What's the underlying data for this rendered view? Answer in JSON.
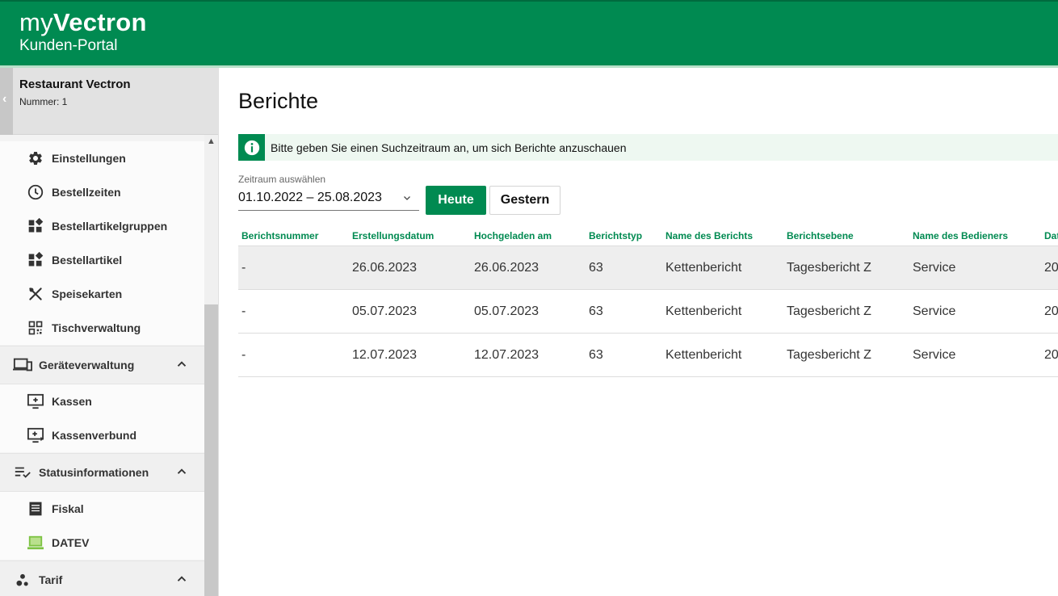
{
  "header": {
    "logo_prefix": "my",
    "logo_brand": "Vectron",
    "subtitle": "Kunden-Portal",
    "brand_color": "#008a51"
  },
  "sidebar": {
    "restaurant_name": "Restaurant Vectron",
    "restaurant_number": "Nummer: 1",
    "items": [
      {
        "label": "Einstellungen",
        "icon": "gear-icon"
      },
      {
        "label": "Bestellzeiten",
        "icon": "clock-icon"
      },
      {
        "label": "Bestellartikelgruppen",
        "icon": "widgets-icon"
      },
      {
        "label": "Bestellartikel",
        "icon": "widgets-icon"
      },
      {
        "label": "Speisekarten",
        "icon": "cutlery-icon"
      },
      {
        "label": "Tischverwaltung",
        "icon": "qr-code-icon"
      }
    ],
    "groups": [
      {
        "label": "Geräteverwaltung",
        "icon": "devices-icon",
        "items": [
          {
            "label": "Kassen",
            "icon": "add-to-queue-icon"
          },
          {
            "label": "Kassenverbund",
            "icon": "queue-play-icon"
          }
        ]
      },
      {
        "label": "Statusinformationen",
        "icon": "checklist-icon",
        "items": [
          {
            "label": "Fiskal",
            "icon": "receipt-icon"
          },
          {
            "label": "DATEV",
            "icon": "computer-icon"
          }
        ]
      },
      {
        "label": "Tarif",
        "icon": "bubble-chart-icon",
        "items": []
      }
    ]
  },
  "main": {
    "title": "Berichte",
    "info_text": "Bitte geben Sie einen Suchzeitraum an, um sich Berichte anzuschauen",
    "date_label": "Zeitraum auswählen",
    "date_value": "01.10.2022 – 25.08.2023",
    "btn_today": "Heute",
    "btn_yesterday": "Gestern",
    "columns": [
      "Berichtsnummer",
      "Erstellungsdatum",
      "Hochgeladen am",
      "Berichtstyp",
      "Name des Berichts",
      "Berichtsebene",
      "Name des Bedieners",
      "Dat"
    ],
    "rows": [
      [
        "-",
        "26.06.2023",
        "26.06.2023",
        "63",
        "Kettenbericht",
        "Tagesbericht Z",
        "Service",
        "20"
      ],
      [
        "-",
        "05.07.2023",
        "05.07.2023",
        "63",
        "Kettenbericht",
        "Tagesbericht Z",
        "Service",
        "20"
      ],
      [
        "-",
        "12.07.2023",
        "12.07.2023",
        "63",
        "Kettenbericht",
        "Tagesbericht Z",
        "Service",
        "20"
      ]
    ]
  }
}
